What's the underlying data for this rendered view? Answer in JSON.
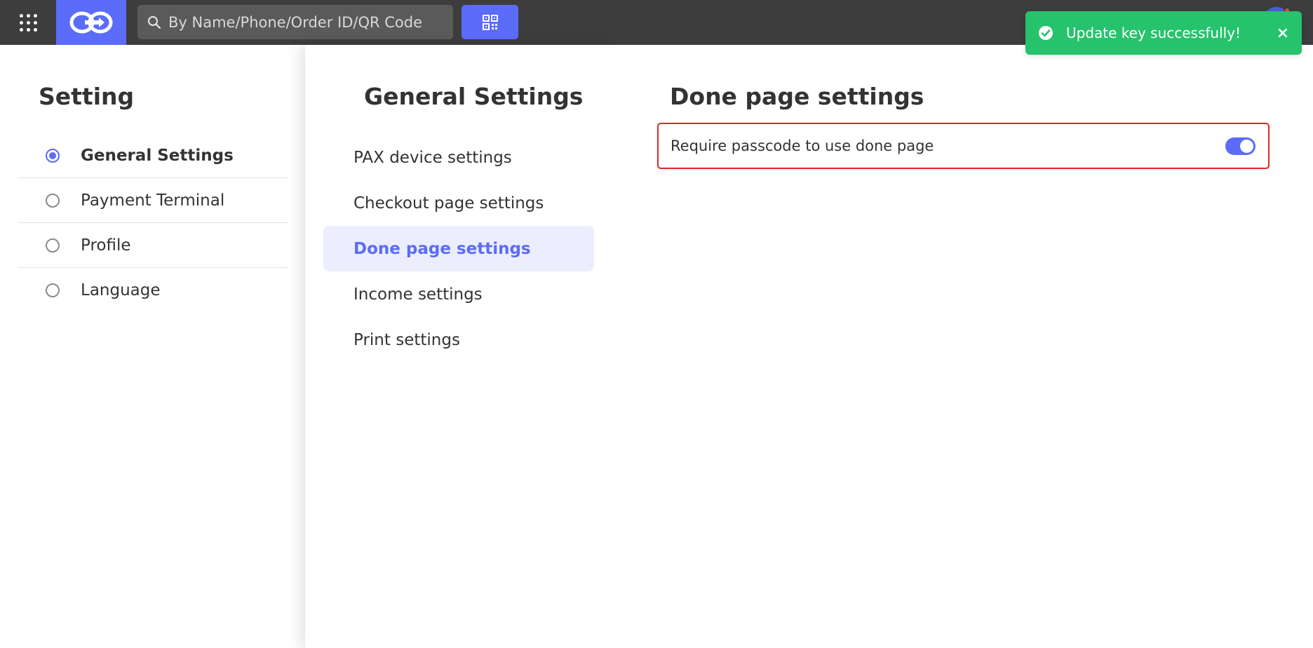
{
  "topbar": {
    "search": {
      "placeholder": "By Name/Phone/Order ID/QR Code",
      "value": ""
    }
  },
  "toast": {
    "message": "Update key successfully!",
    "close_glyph": "×",
    "color": "#27c26c"
  },
  "left_menu": {
    "title": "Setting",
    "items": [
      {
        "label": "General Settings",
        "selected": true
      },
      {
        "label": "Payment Terminal",
        "selected": false
      },
      {
        "label": "Profile",
        "selected": false
      },
      {
        "label": "Language",
        "selected": false
      }
    ]
  },
  "mid_menu": {
    "title": "General Settings",
    "items": [
      {
        "label": "PAX device settings",
        "active": false
      },
      {
        "label": "Checkout page settings",
        "active": false
      },
      {
        "label": "Done page settings",
        "active": true
      },
      {
        "label": "Income settings",
        "active": false
      },
      {
        "label": "Print settings",
        "active": false
      }
    ]
  },
  "content": {
    "title": "Done page settings",
    "settings": [
      {
        "label": "Require passcode to use done page",
        "enabled": true
      }
    ]
  },
  "colors": {
    "accent": "#5b6cf9",
    "topbar": "#3d3d3d",
    "highlight_border": "#e0262b"
  },
  "icons": {
    "apps": "grid-icon",
    "logo": "link-logo-icon",
    "search": "search-icon",
    "qr": "qr-code-icon",
    "toast": "check-circle-icon",
    "close": "close-icon"
  }
}
